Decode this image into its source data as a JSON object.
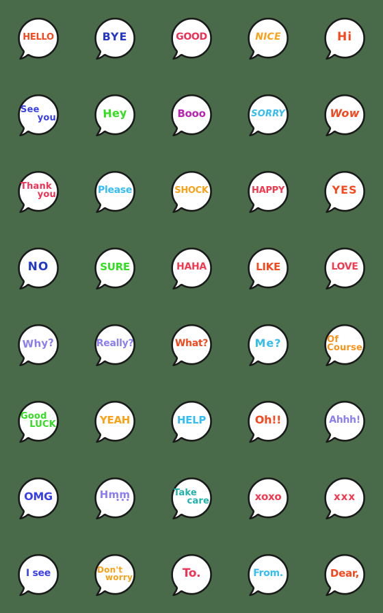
{
  "sheet": {
    "background_color": "#4a6b4a",
    "bubble_fill": "#ffffff",
    "bubble_outline": "#1a1a1a",
    "columns": 5,
    "rows": 8,
    "total_stickers": 40
  },
  "stickers": [
    {
      "id": "hello",
      "text": "HELLO",
      "lines": [
        "HELLO"
      ],
      "color": "#f4481f",
      "size": 13,
      "style": "tight"
    },
    {
      "id": "bye",
      "text": "BYE",
      "lines": [
        "BYE"
      ],
      "color": "#2438c8",
      "size": 16,
      "style": "wide"
    },
    {
      "id": "good",
      "text": "GOOD",
      "lines": [
        "GOOD"
      ],
      "color": "#ee2f56",
      "size": 14,
      "style": "tight"
    },
    {
      "id": "nice",
      "text": "NICE",
      "lines": [
        "NICE"
      ],
      "color": "#f9a219",
      "size": 14,
      "style": "skew"
    },
    {
      "id": "hi",
      "text": "Hi",
      "lines": [
        "Hi"
      ],
      "color": "#f4481f",
      "size": 17,
      "style": "wide"
    },
    {
      "id": "see-you",
      "text": "See you",
      "lines": [
        "See",
        "you"
      ],
      "color": "#3a40e8",
      "size": 13,
      "style": "lines-2"
    },
    {
      "id": "hey",
      "text": "Hey",
      "lines": [
        "Hey"
      ],
      "color": "#33dd22",
      "size": 16,
      "style": "tilt-up"
    },
    {
      "id": "booo",
      "text": "Booo",
      "lines": [
        "Booo"
      ],
      "color": "#bb23b5",
      "size": 15,
      "style": "tight"
    },
    {
      "id": "sorry",
      "text": "SORRY",
      "lines": [
        "SORRY"
      ],
      "color": "#36bdf0",
      "size": 13,
      "style": "skew"
    },
    {
      "id": "wow",
      "text": "Wow",
      "lines": [
        "Wow"
      ],
      "color": "#f4481f",
      "size": 16,
      "style": "skew"
    },
    {
      "id": "thank-you",
      "text": "Thank you",
      "lines": [
        "Thank",
        "you"
      ],
      "color": "#ee3355",
      "size": 13,
      "style": "lines-2"
    },
    {
      "id": "please",
      "text": "Please",
      "lines": [
        "Please"
      ],
      "color": "#36bdf0",
      "size": 14,
      "style": "tight"
    },
    {
      "id": "shock",
      "text": "SHOCK",
      "lines": [
        "SHOCK"
      ],
      "color": "#f9a219",
      "size": 13,
      "style": "tight"
    },
    {
      "id": "happy",
      "text": "HAPPY",
      "lines": [
        "HAPPY"
      ],
      "color": "#f2394f",
      "size": 13,
      "style": "tight"
    },
    {
      "id": "yes",
      "text": "YES",
      "lines": [
        "YES"
      ],
      "color": "#f4481f",
      "size": 16,
      "style": "wide"
    },
    {
      "id": "no",
      "text": "NO",
      "lines": [
        "NO"
      ],
      "color": "#2438c8",
      "size": 17,
      "style": "wide"
    },
    {
      "id": "sure",
      "text": "SURE",
      "lines": [
        "SURE"
      ],
      "color": "#33dd22",
      "size": 15,
      "style": "tight"
    },
    {
      "id": "haha",
      "text": "HAHA",
      "lines": [
        "HAHA"
      ],
      "color": "#f2394f",
      "size": 14,
      "style": "tight"
    },
    {
      "id": "like",
      "text": "LIKE",
      "lines": [
        "LIKE"
      ],
      "color": "#f4481f",
      "size": 15,
      "style": "tight"
    },
    {
      "id": "love",
      "text": "LOVE",
      "lines": [
        "LOVE"
      ],
      "color": "#f2394f",
      "size": 14,
      "style": "tight"
    },
    {
      "id": "why",
      "text": "Why?",
      "lines": [
        "Why?"
      ],
      "color": "#8a7ef0",
      "size": 15,
      "style": "tilt-up"
    },
    {
      "id": "really",
      "text": "Really?",
      "lines": [
        "Really?"
      ],
      "color": "#8a7ef0",
      "size": 14,
      "style": "tight"
    },
    {
      "id": "what",
      "text": "What?",
      "lines": [
        "What?"
      ],
      "color": "#f4481f",
      "size": 14,
      "style": "tight"
    },
    {
      "id": "me",
      "text": "Me?",
      "lines": [
        "Me?"
      ],
      "color": "#36bdf0",
      "size": 16,
      "style": "wide"
    },
    {
      "id": "of-course",
      "text": "Of Course",
      "lines": [
        "Of",
        "Course"
      ],
      "color": "#f9931b",
      "size": 13,
      "style": "lines-2"
    },
    {
      "id": "good-luck",
      "text": "Good LUCK",
      "lines": [
        "Good",
        "LUCK"
      ],
      "color": "#33dd22",
      "size": 13,
      "style": "lines-2"
    },
    {
      "id": "yeah",
      "text": "YEAH",
      "lines": [
        "YEAH"
      ],
      "color": "#f9a219",
      "size": 15,
      "style": "tight"
    },
    {
      "id": "help",
      "text": "HELP",
      "lines": [
        "HELP"
      ],
      "color": "#36bdf0",
      "size": 15,
      "style": "tight"
    },
    {
      "id": "oh",
      "text": "Oh!!",
      "lines": [
        "Oh!!"
      ],
      "color": "#f4481f",
      "size": 16,
      "style": "tight"
    },
    {
      "id": "ahhh",
      "text": "Ahhh!",
      "lines": [
        "Ahhh!"
      ],
      "color": "#8a7ef0",
      "size": 14,
      "style": "tight"
    },
    {
      "id": "omg",
      "text": "OMG",
      "lines": [
        "OMG"
      ],
      "color": "#3a40e8",
      "size": 16,
      "style": "tight"
    },
    {
      "id": "hmm",
      "text": "Hmm...",
      "lines": [
        "Hmm",
        "•••"
      ],
      "color": "#8a7ef0",
      "size": 15,
      "style": "hmm"
    },
    {
      "id": "take-care",
      "text": "Take care",
      "lines": [
        "Take",
        "care"
      ],
      "color": "#20b2aa",
      "size": 13,
      "style": "lines-2"
    },
    {
      "id": "xoxo",
      "text": "xoxo",
      "lines": [
        "xoxo"
      ],
      "color": "#f2394f",
      "size": 15,
      "style": "tight"
    },
    {
      "id": "xxx",
      "text": "xxx",
      "lines": [
        "xxx"
      ],
      "color": "#f2394f",
      "size": 15,
      "style": "wide"
    },
    {
      "id": "i-see",
      "text": "I see",
      "lines": [
        "I see"
      ],
      "color": "#3a40e8",
      "size": 14,
      "style": "tight"
    },
    {
      "id": "dont-worry",
      "text": "Don't worry",
      "lines": [
        "Don't",
        "worry"
      ],
      "color": "#f9a219",
      "size": 12,
      "style": "lines-2"
    },
    {
      "id": "to",
      "text": "To.",
      "lines": [
        "To."
      ],
      "color": "#ee3355",
      "size": 17,
      "style": "tight"
    },
    {
      "id": "from",
      "text": "From.",
      "lines": [
        "From."
      ],
      "color": "#36bdf0",
      "size": 14,
      "style": "tight"
    },
    {
      "id": "dear",
      "text": "Dear,",
      "lines": [
        "Dear,"
      ],
      "color": "#f4481f",
      "size": 15,
      "style": "tight"
    }
  ]
}
